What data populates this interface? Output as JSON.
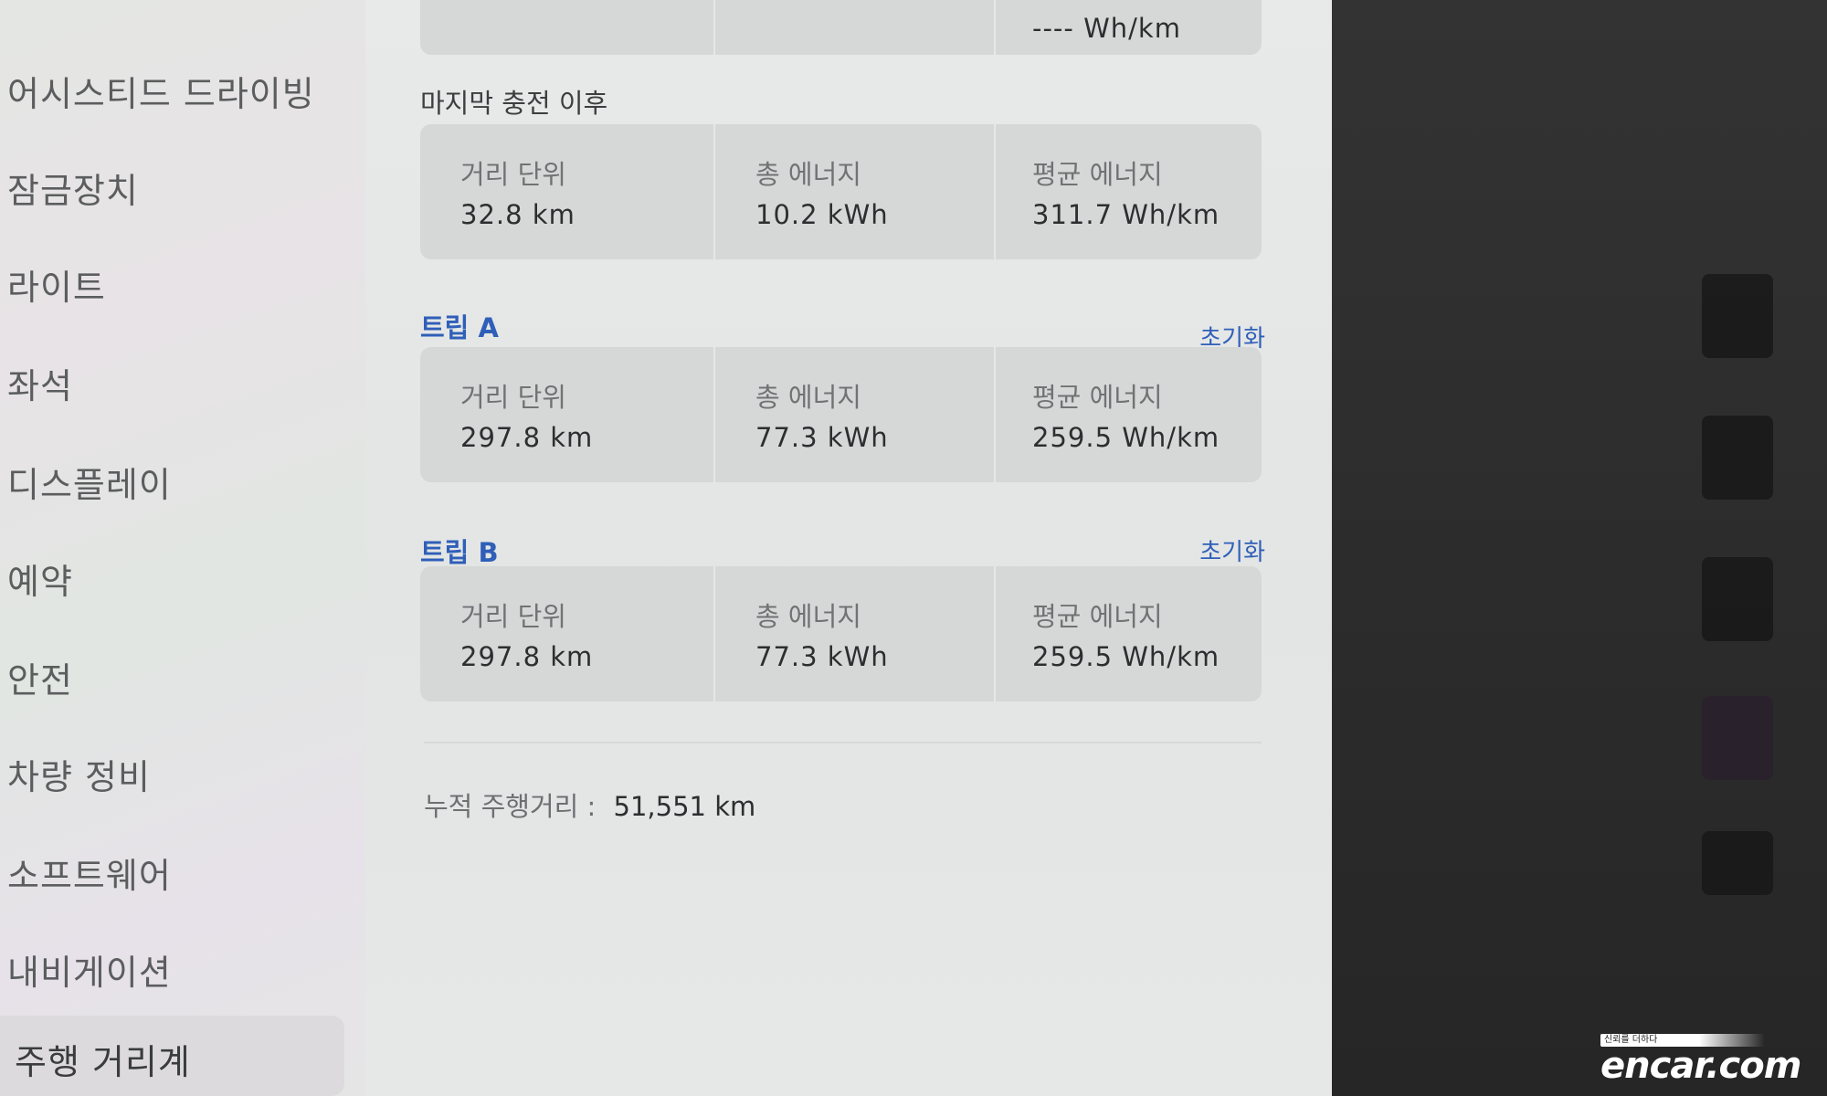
{
  "sidebar": {
    "items": [
      {
        "label": "어시스티드 드라이빙"
      },
      {
        "label": "잠금장치"
      },
      {
        "label": "라이트"
      },
      {
        "label": "좌석"
      },
      {
        "label": "디스플레이"
      },
      {
        "label": "예약"
      },
      {
        "label": "안전"
      },
      {
        "label": "차량 정비"
      },
      {
        "label": "소프트웨어"
      },
      {
        "label": "내비게이션"
      },
      {
        "label": "주행 거리계"
      }
    ],
    "active_index": 10
  },
  "main": {
    "top_partial_value": "---- Wh/km",
    "since_charge": {
      "title": "마지막 충전 이후",
      "distance_label": "거리 단위",
      "distance_value": "32.8 km",
      "energy_label": "총 에너지",
      "energy_value": "10.2 kWh",
      "avg_label": "평균 에너지",
      "avg_value": "311.7 Wh/km"
    },
    "trip_a": {
      "title": "트립 A",
      "reset_label": "초기화",
      "distance_label": "거리 단위",
      "distance_value": "297.8 km",
      "energy_label": "총 에너지",
      "energy_value": "77.3 kWh",
      "avg_label": "평균 에너지",
      "avg_value": "259.5 Wh/km"
    },
    "trip_b": {
      "title": "트립 B",
      "reset_label": "초기화",
      "distance_label": "거리 단위",
      "distance_value": "297.8 km",
      "energy_label": "총 에너지",
      "energy_value": "77.3 kWh",
      "avg_label": "평균 에너지",
      "avg_value": "259.5 Wh/km"
    },
    "odometer": {
      "label": "누적 주행거리 :",
      "value": "51,551 km"
    }
  },
  "watermark": {
    "tagline": "신뢰를 더하다",
    "brand": "encar.com"
  },
  "colors": {
    "accent_blue": "#2f5fb8",
    "card_bg": "#d6d8d8",
    "screen_bg": "#e6e8e8"
  }
}
